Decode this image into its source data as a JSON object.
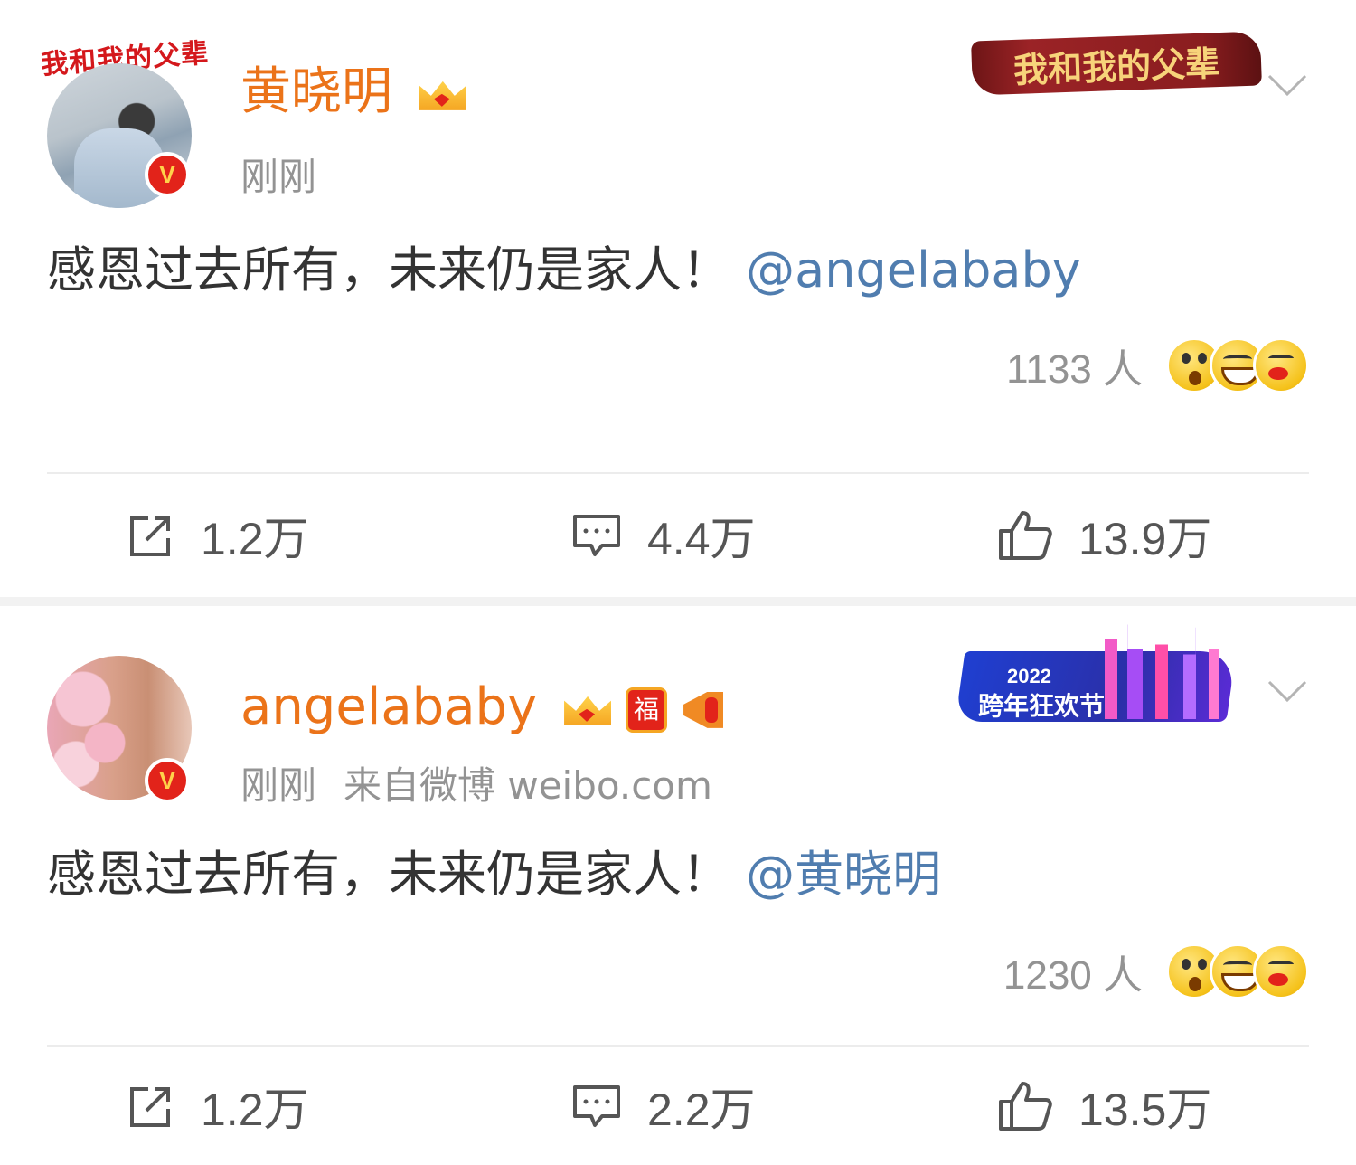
{
  "posts": [
    {
      "username": "黄晓明",
      "avatar_logo": "我和我的父辈",
      "verified_badge": "V",
      "time": "刚刚",
      "source": "",
      "decoration_text": "我和我的父辈",
      "content_text": "感恩过去所有，未来仍是家人！",
      "mention": "@angelababy",
      "reaction_count": "1133 人",
      "actions": {
        "share": "1.2万",
        "comment": "4.4万",
        "like": "13.9万"
      }
    },
    {
      "username": "angelababy",
      "verified_badge": "V",
      "fu_badge": "福",
      "time": "刚刚",
      "source": "来自微博 weibo.com",
      "decoration_year": "2022",
      "decoration_text": "跨年狂欢节",
      "content_text": "感恩过去所有，未来仍是家人！",
      "mention": "@黄晓明",
      "reaction_count": "1230 人",
      "actions": {
        "share": "1.2万",
        "comment": "2.2万",
        "like": "13.5万"
      }
    }
  ],
  "colors": {
    "username": "#eb7319",
    "mention": "#507daf",
    "meta": "#939393",
    "badge": "#e2231a"
  },
  "icons": [
    "share-icon",
    "comment-icon",
    "like-icon",
    "chevron-down-icon",
    "crown-icon",
    "megaphone-icon"
  ]
}
